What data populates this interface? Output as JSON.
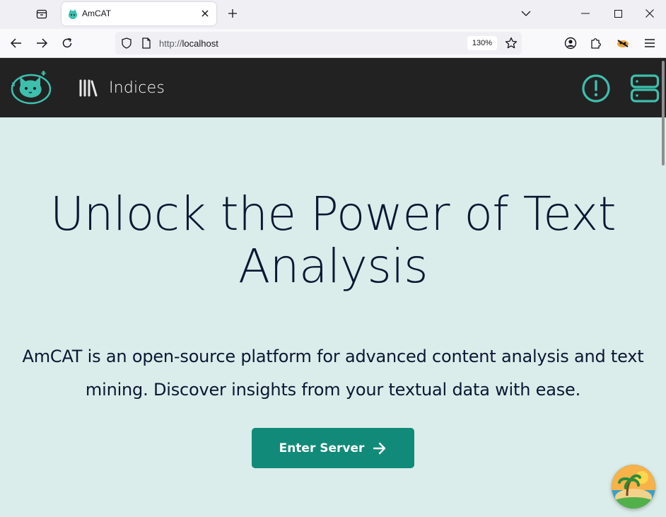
{
  "browser": {
    "tab_title": "AmCAT",
    "url_scheme": "http://",
    "url_host": "localhost",
    "zoom_level": "130%",
    "icons": [
      "tab-list-icon",
      "tab-favicon",
      "close-icon",
      "plus-icon",
      "chevron-down-icon",
      "minimize-icon",
      "maximize-icon",
      "close-window-icon",
      "back-arrow-icon",
      "forward-arrow-icon",
      "reload-icon",
      "shield-icon",
      "page-icon",
      "star-icon",
      "account-icon",
      "extensions-icon",
      "extension-icon",
      "menu-icon"
    ]
  },
  "header": {
    "nav_label": "Indices",
    "icons": [
      "amcat-cat-logo",
      "library-icon",
      "alert-circle-icon",
      "server-icon"
    ]
  },
  "hero": {
    "title": "Unlock the Power of Text Analysis",
    "subtitle": "AmCAT is an open-source platform for advanced content analysis and text mining. Discover insights from your textual data with ease.",
    "button_label": "Enter Server"
  },
  "colors": {
    "header_bg": "#222222",
    "page_bg": "#dbedea",
    "accent": "#3dbfad",
    "button_bg": "#128a79",
    "text": "#0b1733"
  }
}
